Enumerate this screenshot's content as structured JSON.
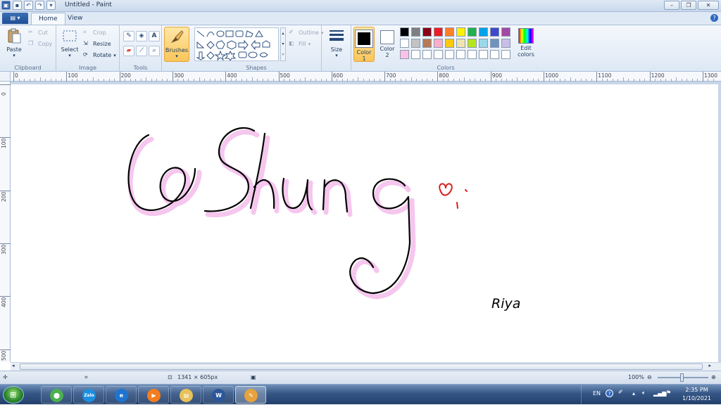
{
  "window": {
    "title": "Untitled - Paint",
    "controls": {
      "minimize": "–",
      "restore": "❐",
      "close": "✕"
    }
  },
  "tabs": [
    {
      "label": "Home",
      "active": true
    },
    {
      "label": "View",
      "active": false
    }
  ],
  "ribbon": {
    "clipboard": {
      "label": "Clipboard",
      "paste": "Paste",
      "cut": "Cut",
      "copy": "Copy"
    },
    "image": {
      "label": "Image",
      "select": "Select",
      "crop": "Crop",
      "resize": "Resize",
      "rotate": "Rotate"
    },
    "tools": {
      "label": "Tools"
    },
    "brushes": {
      "label": "Brushes"
    },
    "shapes": {
      "label": "Shapes",
      "outline": "Outline",
      "fill": "Fill"
    },
    "size": {
      "label": "Size"
    },
    "colors": {
      "label": "Colors",
      "color1_label": "Color",
      "color1_num": "1",
      "color2_label": "Color",
      "color2_num": "2",
      "edit_colors": "Edit",
      "edit_colors2": "colors",
      "color1": "#000000",
      "color2": "#ffffff",
      "palette_row1": [
        "#000000",
        "#7f7f7f",
        "#880015",
        "#ed1c24",
        "#ff7f27",
        "#fff200",
        "#22b14c",
        "#00a2e8",
        "#3f48cc",
        "#a349a4"
      ],
      "palette_row2": [
        "#ffffff",
        "#c3c3c3",
        "#b97a57",
        "#ffaec9",
        "#ffc90e",
        "#efe4b0",
        "#b5e61d",
        "#99d9ea",
        "#7092be",
        "#c8bfe7"
      ],
      "palette_row3": [
        "#ffc0e6",
        "#ffffff",
        "#ffffff",
        "#ffffff",
        "#ffffff",
        "#ffffff",
        "#ffffff",
        "#ffffff",
        "#ffffff",
        "#ffffff"
      ]
    }
  },
  "ruler": {
    "h_labels": [
      "0",
      "100",
      "200",
      "300",
      "400",
      "500",
      "600",
      "700",
      "800",
      "900",
      "1000",
      "1100",
      "1200",
      "1300"
    ],
    "v_labels": [
      "0",
      "100",
      "200",
      "300",
      "400",
      "500"
    ]
  },
  "canvas_art": {
    "main_text": "@Shung",
    "signature": "Riya",
    "outline_color": "#000000",
    "shadow_color": "#f5c6ee",
    "heart_color": "#d92020"
  },
  "status": {
    "dimensions": "1341 × 605px",
    "zoom": "100%"
  },
  "taskbar": {
    "items": [
      {
        "name": "chrome",
        "glyph": "⬤",
        "color": "#4caf50"
      },
      {
        "name": "zalo",
        "glyph": "Zalo",
        "color": "#1d8fe1"
      },
      {
        "name": "ie",
        "glyph": "e",
        "color": "#1e74d0"
      },
      {
        "name": "media",
        "glyph": "▶",
        "color": "#f57c1f"
      },
      {
        "name": "explorer",
        "glyph": "▤",
        "color": "#e8c15a"
      },
      {
        "name": "word",
        "glyph": "W",
        "color": "#2b579a"
      },
      {
        "name": "paint",
        "glyph": "✎",
        "color": "#e6a23c",
        "active": true
      }
    ],
    "lang": "EN",
    "time": "2:35 PM",
    "date": "1/10/2021"
  }
}
